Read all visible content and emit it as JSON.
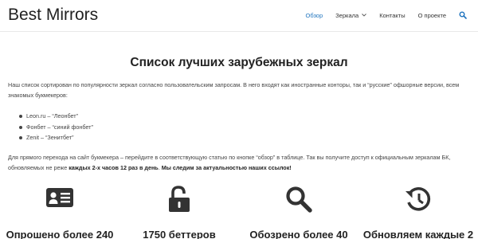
{
  "site": {
    "logo": "Best Mirrors"
  },
  "nav": {
    "items": [
      {
        "label": "Обзор",
        "active": true
      },
      {
        "label": "Зеркала",
        "has_dropdown": true
      },
      {
        "label": "Контакты"
      },
      {
        "label": "О проекте"
      }
    ],
    "search_icon": "search-icon"
  },
  "main": {
    "title": "Список лучших зарубежных зеркал",
    "intro": "Наш список сортирован по популярности зеркал согласно пользовательским запросам. В него входят как иностранные конторы, так и “русские” офшорные версии, всем знакомых букмекеров:",
    "list": [
      "Leon.ru – “Леонбет”",
      "Фонбет – “синий фонбет”",
      "Zenit – “Зенитбет”"
    ],
    "p2_text1": "Для прямого перехода на сайт букмекера – перейдите в соответствующую статью по кнопке “обзор” в таблице. Так вы получите доступ к официальным зеркалам БК, обновляемых не реже ",
    "p2_bold1": "каждых 2-х часов 12 раз в день",
    "p2_text2": ". ",
    "p2_bold2": "Мы следим за актуальностью наших ссылок!"
  },
  "features": [
    {
      "icon": "id-card-icon",
      "title": "Опрошено более 240"
    },
    {
      "icon": "unlock-icon",
      "title": "1750 беттеров"
    },
    {
      "icon": "search-icon",
      "title": "Обозрено более 40"
    },
    {
      "icon": "history-icon",
      "title": "Обновляем каждые 2"
    }
  ],
  "colors": {
    "accent": "#1e73be",
    "icon": "#333333",
    "text": "#444444"
  }
}
